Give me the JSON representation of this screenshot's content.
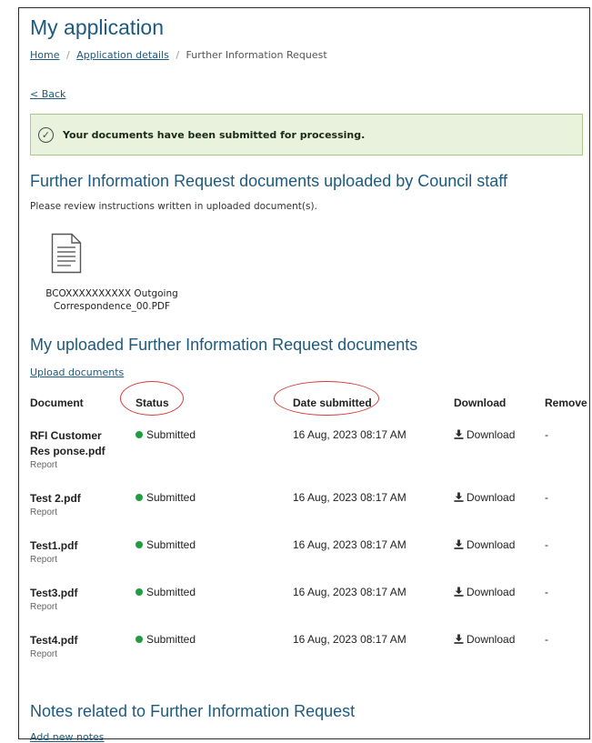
{
  "page_title": "My application",
  "breadcrumb": {
    "home": "Home",
    "separator": "/",
    "details": "Application details",
    "current": "Further Information Request"
  },
  "back_link": "< Back",
  "alert": {
    "message": "Your documents have been submitted for processing.",
    "icon": "check-circle-icon",
    "color": "#e8f2dc"
  },
  "council_docs": {
    "heading": "Further Information Request documents uploaded by Council staff",
    "instructions": "Please review instructions written in uploaded document(s).",
    "file_name_line1": "BCOXXXXXXXXXX Outgoing",
    "file_name_line2": "Correspondence_00.PDF",
    "file_icon": "document-icon"
  },
  "my_docs": {
    "heading": "My uploaded Further Information Request documents",
    "upload_link": "Upload documents",
    "columns": {
      "document": "Document",
      "status": "Status",
      "date": "Date submitted",
      "download": "Download",
      "remove": "Remove"
    },
    "rows": [
      {
        "name": "RFI Customer Res ponse.pdf",
        "type": "Report",
        "status": "Submitted",
        "date": "16 Aug, 2023 08:17 AM",
        "download": "Download",
        "remove": "-"
      },
      {
        "name": "Test 2.pdf",
        "type": "Report",
        "status": "Submitted",
        "date": "16 Aug, 2023 08:17 AM",
        "download": "Download",
        "remove": "-"
      },
      {
        "name": "Test1.pdf",
        "type": "Report",
        "status": "Submitted",
        "date": "16 Aug, 2023 08:17 AM",
        "download": "Download",
        "remove": "-"
      },
      {
        "name": "Test3.pdf",
        "type": "Report",
        "status": "Submitted",
        "date": "16 Aug, 2023 08:17 AM",
        "download": "Download",
        "remove": "-"
      },
      {
        "name": "Test4.pdf",
        "type": "Report",
        "status": "Submitted",
        "date": "16 Aug, 2023 08:17 AM",
        "download": "Download",
        "remove": "-"
      }
    ],
    "status_color": "#1e9e3e"
  },
  "notes": {
    "heading": "Notes related to Further Information Request",
    "add_link": "Add new notes"
  },
  "annotation_color": "#d63b3b"
}
